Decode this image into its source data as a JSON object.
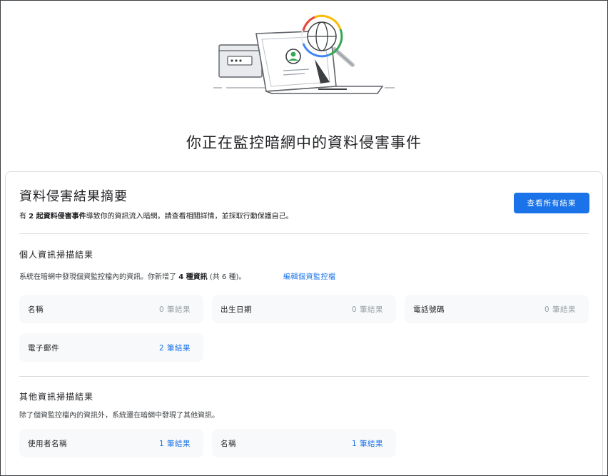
{
  "page_title": "你正在監控暗網中的資料侵害事件",
  "summary": {
    "title": "資料侵害結果摘要",
    "desc_prefix": "有 ",
    "desc_count": "2 起資料侵害事件",
    "desc_suffix": "導致你的資訊流入暗網。請查看相關詳情，並採取行動保護自己。",
    "view_all_label": "查看所有結果"
  },
  "personal": {
    "title": "個人資訊掃描結果",
    "desc_prefix": "系統在暗網中發現個資監控檔內的資訊。你新增了 ",
    "desc_count": "4 種資訊",
    "desc_suffix": " (共 6 種)。",
    "edit_label": "編輯個資監控檔",
    "items": [
      {
        "label": "名稱",
        "result": "0 筆結果"
      },
      {
        "label": "出生日期",
        "result": "0 筆結果"
      },
      {
        "label": "電話號碼",
        "result": "0 筆結果"
      },
      {
        "label": "電子郵件",
        "result": "2 筆結果"
      }
    ]
  },
  "other": {
    "title": "其他資訊掃描結果",
    "desc": "除了個資監控檔內的資訊外，系統還在暗網中發現了其他資訊。",
    "items": [
      {
        "label": "使用者名稱",
        "result": "1 筆結果"
      },
      {
        "label": "名稱",
        "result": "1 筆結果"
      }
    ]
  },
  "colors": {
    "accent": "#1a73e8",
    "zero_result": "#9aa0a6",
    "tile_bg": "#f8f9fa",
    "divider": "#dadce0",
    "logo_red": "#ea4335",
    "logo_yellow": "#fbbc04",
    "logo_green": "#34a853",
    "logo_blue": "#4285f4"
  },
  "icons": [
    "laptop-illustration",
    "browser-window-illustration",
    "magnifier-globe-icon",
    "avatar-icon"
  ]
}
